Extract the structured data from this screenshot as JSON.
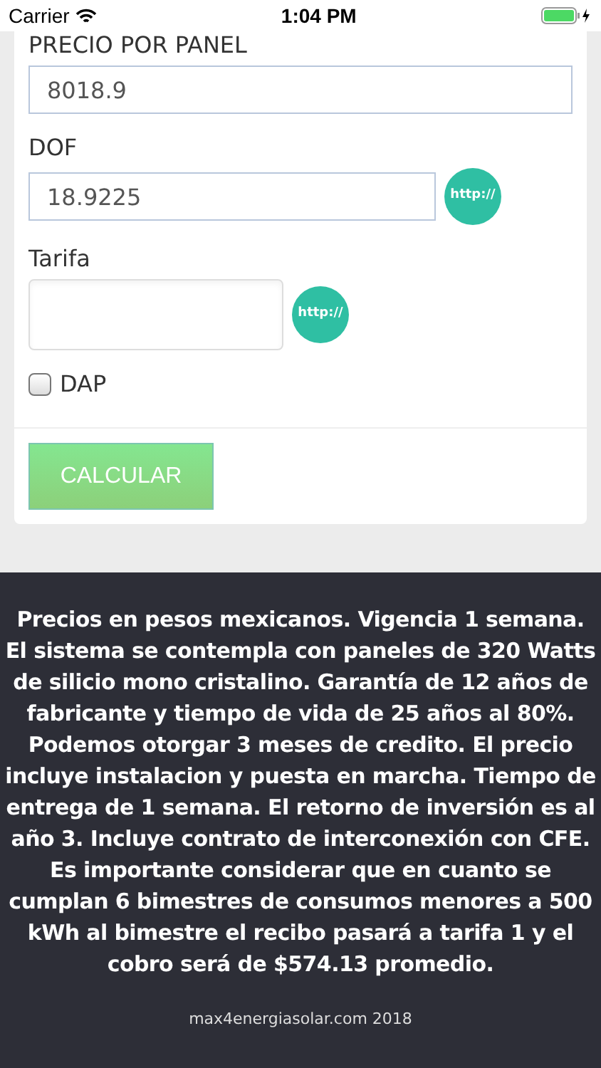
{
  "status_bar": {
    "carrier": "Carrier",
    "time": "1:04 PM"
  },
  "fields": [
    {
      "kind": "input",
      "label": "PRECIO POR PANEL",
      "value": "8018.9"
    },
    {
      "kind": "input_link",
      "label": "DOF",
      "value": "18.9225",
      "link": "http://"
    },
    {
      "kind": "textarea_link",
      "label": "Tarifa",
      "link": "http://"
    }
  ],
  "dap": {
    "label": "DAP",
    "checked": false
  },
  "calculate_button": "CALCULAR",
  "notice": "Precios en pesos mexicanos. Vigencia 1 semana. El sistema se contempla con paneles de 320 Watts de silicio mono cristalino. Garantía de 12 años de fabricante y tiempo de vida de 25 años al 80%. Podemos otorgar 3 meses de credito. El precio incluye instalacion y puesta en marcha. Tiempo de entrega de 1 semana. El retorno de inversión es al año 3. Incluye contrato de interconexión con CFE. Es importante considerar que en cuanto se cumplan 6 bimestres de consumos menores a 500 kWh al bimestre el recibo pasará a tarifa 1 y el cobro será de $574.13 promedio.",
  "footer": "max4energiasolar.com 2018"
}
